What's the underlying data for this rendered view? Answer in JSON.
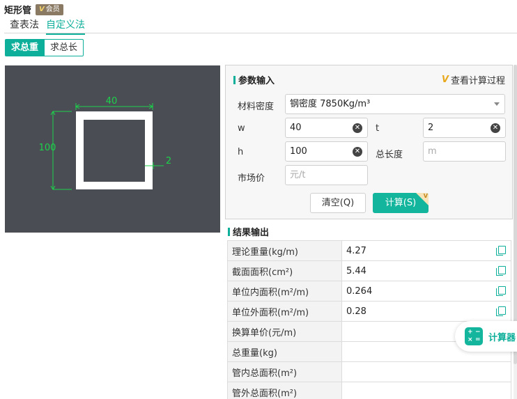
{
  "header": {
    "title": "矩形管",
    "badge_v": "V",
    "badge_text": "会员"
  },
  "tabs": [
    {
      "label": "查表法",
      "active": false
    },
    {
      "label": "自定义法",
      "active": true
    }
  ],
  "mode": {
    "total_weight_label": "求总重",
    "total_length_label": "求总长"
  },
  "diagram": {
    "width_label": "40",
    "height_label": "100",
    "thickness_label": "2",
    "line_color": "#1cd34a",
    "shape_color": "#ffffff",
    "background": "#4b4d55"
  },
  "params": {
    "section_title": "参数输入",
    "view_process_label": "查看计算过程",
    "view_process_icon": "vip-icon",
    "density_label": "材料密度",
    "density_value": "钢密度 7850Kg/m³",
    "w_label": "w",
    "w_value": "40",
    "t_label": "t",
    "t_value": "2",
    "h_label": "h",
    "h_value": "100",
    "total_length_label": "总长度",
    "total_length_placeholder": "m",
    "price_label": "市场价",
    "price_placeholder": "元/t",
    "clear_button": "清空(Q)",
    "calc_button": "计算(S)",
    "calc_corner_v": "V"
  },
  "results": {
    "section_title": "结果输出",
    "rows": [
      {
        "label": "理论重量(kg/m)",
        "value": "4.27",
        "copy": true
      },
      {
        "label": "截面面积(cm²)",
        "value": "5.44",
        "copy": true
      },
      {
        "label": "单位内面积(m²/m)",
        "value": "0.264",
        "copy": true
      },
      {
        "label": "单位外面积(m²/m)",
        "value": "0.28",
        "copy": true
      },
      {
        "label": "换算单价(元/m)",
        "value": "",
        "copy": false
      },
      {
        "label": "总重量(kg)",
        "value": "",
        "copy": false
      },
      {
        "label": "管内总面积(m²)",
        "value": "",
        "copy": false
      },
      {
        "label": "管外总面积(m²)",
        "value": "",
        "copy": false
      }
    ]
  },
  "floating": {
    "calculator_label": "计算器",
    "icon": "calculator-icon"
  },
  "colors": {
    "accent": "#0eaf9a",
    "button": "#13b59c"
  }
}
